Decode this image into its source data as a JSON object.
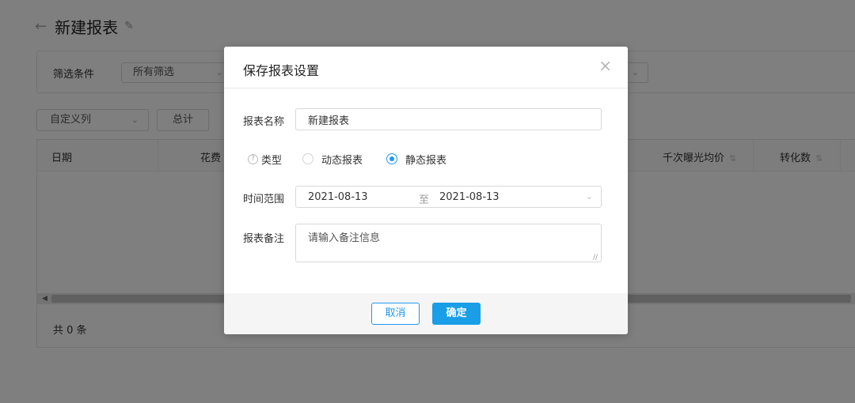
{
  "page": {
    "title": "新建报表",
    "filter": {
      "label": "筛选条件",
      "select_value": "所有筛选"
    },
    "toolbar": {
      "custom_columns": "自定义列",
      "total": "总计"
    },
    "table": {
      "columns": [
        "日期",
        "花费",
        "千次曝光均价",
        "转化数"
      ],
      "count_text": "共 0 条"
    }
  },
  "modal": {
    "title": "保存报表设置",
    "close_icon": "close-icon",
    "fields": {
      "name_label": "报表名称",
      "name_value": "新建报表",
      "type_label": "类型",
      "type_options": [
        {
          "label": "动态报表",
          "checked": false
        },
        {
          "label": "静态报表",
          "checked": true
        }
      ],
      "time_label": "时间范围",
      "date_start": "2021-08-13",
      "date_separator": "至",
      "date_end": "2021-08-13",
      "note_label": "报表备注",
      "note_placeholder": "请输入备注信息"
    },
    "footer": {
      "cancel": "取消",
      "ok": "确定"
    }
  },
  "colors": {
    "accent": "#2196f3",
    "primary_button": "#1a9ee8",
    "overlay": "rgba(0,0,0,0.5)"
  }
}
